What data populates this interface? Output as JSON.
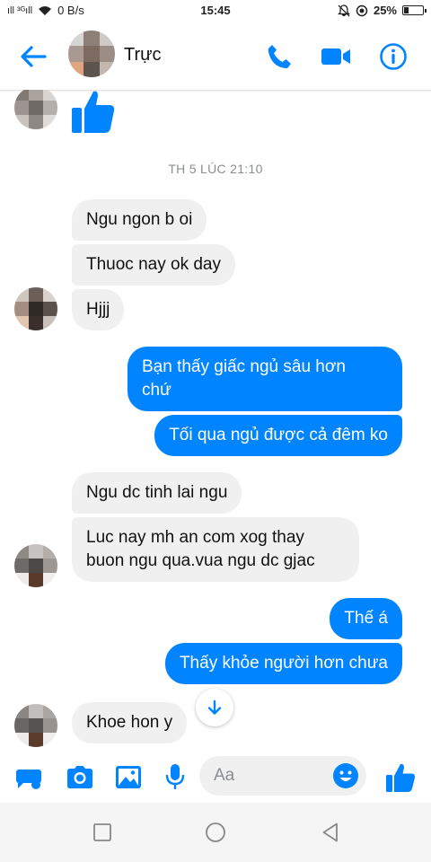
{
  "status_bar": {
    "signal_text": "ıll ³ᴳıll",
    "speed": "0 B/s",
    "time": "15:45",
    "battery": "25%"
  },
  "header": {
    "back_icon": "arrow-left-icon",
    "contact_name": "Trực",
    "call_icon": "phone-icon",
    "video_icon": "video-camera-icon",
    "info_icon": "info-icon"
  },
  "chat": {
    "timestamp": "TH 5 LÚC 21:10",
    "messages": [
      {
        "side": "in",
        "text": "Ngu ngon b oi"
      },
      {
        "side": "in",
        "text": "Thuoc nay ok day"
      },
      {
        "side": "in",
        "text": "Hjjj"
      },
      {
        "side": "out",
        "line1": "Bạn thấy giấc ngủ sâu hơn",
        "line2": "chứ"
      },
      {
        "side": "out",
        "text": "Tối qua ngủ được cả đêm ko"
      },
      {
        "side": "in",
        "text": "Ngu dc tinh lai ngu"
      },
      {
        "side": "in",
        "line1": "Luc nay mh an com xog thay",
        "line2": "buon ngu qua.vua ngu dc gjac"
      },
      {
        "side": "out",
        "text": "Thế á"
      },
      {
        "side": "out",
        "text": "Thấy khỏe người hơn chưa"
      },
      {
        "side": "in",
        "text": "Khoe hon y"
      }
    ]
  },
  "composer": {
    "placeholder": "Aa",
    "tools": [
      "more-icon",
      "camera-icon",
      "image-icon",
      "microphone-icon"
    ],
    "emoji_icon": "emoji-icon",
    "like_icon": "thumbs-up-icon"
  },
  "colors": {
    "accent": "#0084ff",
    "incoming_bubble": "#f1f0f0"
  }
}
